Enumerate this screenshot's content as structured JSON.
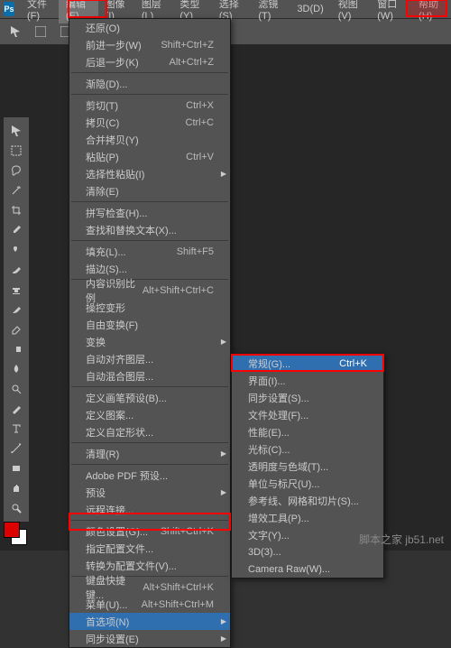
{
  "logo": "Ps",
  "menubar": [
    "文件(F)",
    "编辑(E)",
    "图像(I)",
    "图层(L)",
    "类型(Y)",
    "选择(S)",
    "滤镜(T)",
    "3D(D)",
    "视图(V)",
    "窗口(W)",
    "帮助(H)"
  ],
  "editMenu": {
    "groups": [
      [
        {
          "label": "还原(O)",
          "short": ""
        },
        {
          "label": "前进一步(W)",
          "short": "Shift+Ctrl+Z"
        },
        {
          "label": "后退一步(K)",
          "short": "Alt+Ctrl+Z"
        }
      ],
      [
        {
          "label": "渐隐(D)...",
          "short": "",
          "disabled": true
        }
      ],
      [
        {
          "label": "剪切(T)",
          "short": "Ctrl+X"
        },
        {
          "label": "拷贝(C)",
          "short": "Ctrl+C"
        },
        {
          "label": "合并拷贝(Y)",
          "short": ""
        },
        {
          "label": "粘贴(P)",
          "short": "Ctrl+V"
        },
        {
          "label": "选择性粘贴(I)",
          "short": "",
          "sub": true
        },
        {
          "label": "清除(E)",
          "short": ""
        }
      ],
      [
        {
          "label": "拼写检查(H)...",
          "short": ""
        },
        {
          "label": "查找和替换文本(X)...",
          "short": ""
        }
      ],
      [
        {
          "label": "填充(L)...",
          "short": "Shift+F5"
        },
        {
          "label": "描边(S)...",
          "short": ""
        }
      ],
      [
        {
          "label": "内容识别比例",
          "short": "Alt+Shift+Ctrl+C"
        },
        {
          "label": "操控变形",
          "short": ""
        },
        {
          "label": "自由变换(F)",
          "short": ""
        },
        {
          "label": "变换",
          "short": "",
          "sub": true
        },
        {
          "label": "自动对齐图层...",
          "short": ""
        },
        {
          "label": "自动混合图层...",
          "short": ""
        }
      ],
      [
        {
          "label": "定义画笔预设(B)...",
          "short": ""
        },
        {
          "label": "定义图案...",
          "short": ""
        },
        {
          "label": "定义自定形状...",
          "short": ""
        }
      ],
      [
        {
          "label": "清理(R)",
          "short": "",
          "sub": true
        }
      ],
      [
        {
          "label": "Adobe PDF 预设...",
          "short": ""
        },
        {
          "label": "预设",
          "short": "",
          "sub": true
        },
        {
          "label": "远程连接...",
          "short": ""
        }
      ],
      [
        {
          "label": "颜色设置(G)...",
          "short": "Shift+Ctrl+K"
        },
        {
          "label": "指定配置文件...",
          "short": ""
        },
        {
          "label": "转换为配置文件(V)...",
          "short": ""
        }
      ],
      [
        {
          "label": "键盘快捷键...",
          "short": "Alt+Shift+Ctrl+K"
        },
        {
          "label": "菜单(U)...",
          "short": "Alt+Shift+Ctrl+M"
        },
        {
          "label": "首选项(N)",
          "short": "",
          "sub": true,
          "hover": true
        },
        {
          "label": "同步设置(E)",
          "short": "",
          "sub": true
        }
      ]
    ]
  },
  "prefSubmenu": [
    {
      "label": "常规(G)...",
      "short": "Ctrl+K",
      "hover": true
    },
    {
      "label": "界面(I)...",
      "short": ""
    },
    {
      "label": "同步设置(S)...",
      "short": ""
    },
    {
      "label": "文件处理(F)...",
      "short": ""
    },
    {
      "label": "性能(E)...",
      "short": ""
    },
    {
      "label": "光标(C)...",
      "short": ""
    },
    {
      "label": "透明度与色域(T)...",
      "short": ""
    },
    {
      "label": "单位与标尺(U)...",
      "short": ""
    },
    {
      "label": "参考线、网格和切片(S)...",
      "short": ""
    },
    {
      "label": "增效工具(P)...",
      "short": ""
    },
    {
      "label": "文字(Y)...",
      "short": ""
    },
    {
      "label": "3D(3)...",
      "short": ""
    },
    {
      "label": "Camera Raw(W)...",
      "short": ""
    }
  ],
  "toolbox": [
    "move",
    "marquee",
    "lasso",
    "wand",
    "crop",
    "eyedrop",
    "heal",
    "brush",
    "stamp",
    "history",
    "eraser",
    "gradient",
    "blur",
    "dodge",
    "pen",
    "type",
    "path",
    "rect",
    "hand",
    "zoom"
  ],
  "watermark": "脚本之家 jb51.net"
}
